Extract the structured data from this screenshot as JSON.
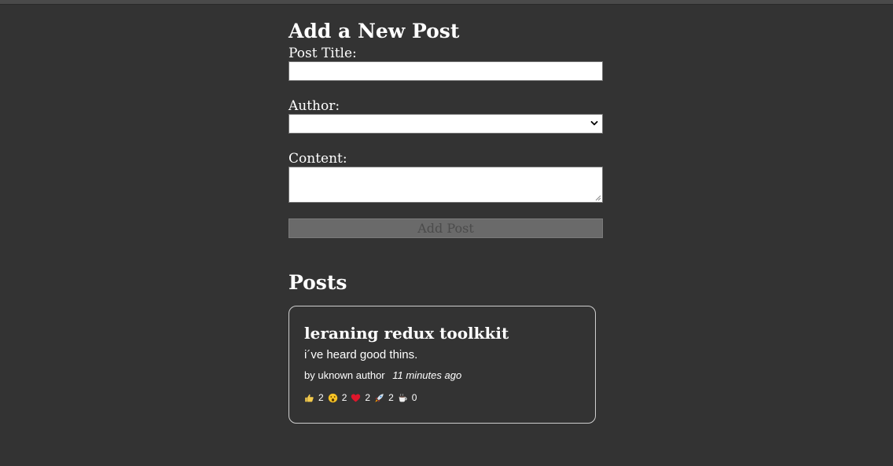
{
  "form": {
    "heading": "Add a New Post",
    "title_label": "Post Title:",
    "title_value": "",
    "author_label": "Author:",
    "author_selected": "",
    "content_label": "Content:",
    "content_value": "",
    "submit_label": "Add Post"
  },
  "posts": {
    "heading": "Posts",
    "items": [
      {
        "title": "leraning redux toolkkit",
        "content": "i´ve heard good thins.",
        "author": "by uknown author",
        "time": "11 minutes ago",
        "reactions": [
          {
            "icon": "thumbs-up-icon",
            "count": "2"
          },
          {
            "icon": "wow-face-icon",
            "count": "2"
          },
          {
            "icon": "heart-icon",
            "count": "2"
          },
          {
            "icon": "rocket-icon",
            "count": "2"
          },
          {
            "icon": "coffee-icon",
            "count": "0"
          }
        ]
      }
    ]
  },
  "colors": {
    "background": "#333333",
    "text": "#ffffff",
    "button_disabled_bg": "#6a6a6a",
    "button_disabled_text": "#4b4b4b",
    "card_border": "#cfcfcf"
  }
}
